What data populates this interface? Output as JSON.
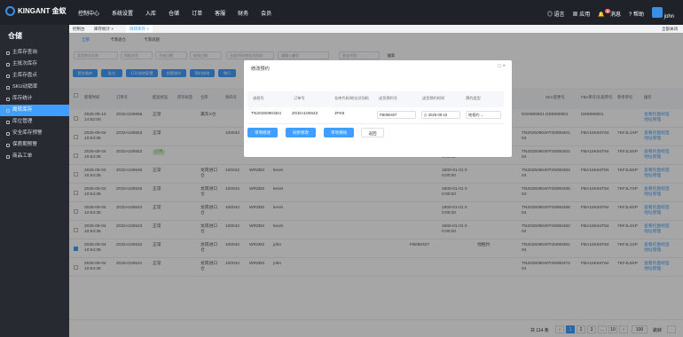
{
  "app": {
    "brand": "KINGANT 金蚁",
    "nav": [
      "控制中心",
      "系统设置",
      "入库",
      "仓储",
      "订单",
      "客服",
      "财务",
      "会员"
    ],
    "lang": "语言",
    "apps": "应用",
    "news": "消息",
    "news_count": "8",
    "help": "帮助",
    "user": "john"
  },
  "sidebar": {
    "title": "仓储",
    "items": [
      "主库存查询",
      "主批次库存",
      "主库存盘点",
      "SKU动销率",
      "库存统计",
      "周转库存",
      "库位管理",
      "安全库存预警",
      "保质期预警",
      "商品工单"
    ],
    "active": 5
  },
  "tabs": {
    "items": [
      "控制台",
      "库存统计",
      "周转库存"
    ],
    "right": "全部关闭"
  },
  "subtabs": [
    "全部",
    "卡落退仓",
    "卡落退越"
  ],
  "filters": [
    "发货库存仓库",
    "同批次号",
    "开始日期",
    "结束日期",
    "全部代码/地址识别码",
    "请输入编号",
    "安全代码",
    "搜索"
  ],
  "buttons": [
    "提交备库",
    "批次",
    "打印流转配置",
    "前置操作",
    "预约修改",
    "增行"
  ],
  "table": {
    "headers": [
      "新增时间",
      "订单号",
      "配送状态",
      "库存标签",
      "仓库",
      "条码号",
      "仓库代码",
      "操作人",
      "关联人",
      "发货代码",
      "在途状态",
      "备注",
      "SKU变更号",
      "FBA单号/头程单号",
      "参考单号",
      "操作"
    ],
    "rows": [
      {
        "time": "2025-09-10\n14:52:00",
        "order": "ZGDA100656",
        "status": "正常",
        "tag": "",
        "wh": "美东X仓",
        "code": "",
        "op": "",
        "rel": "",
        "ship": "",
        "date": "",
        "remark": "",
        "sn": "DG0900601",
        "sku": "DD9090001",
        "fba": "DD9090001",
        "ref": "",
        "act": "查看托盘标签\n地址管理",
        "checked": false
      },
      {
        "time": "2025-09-04\n10:54:35",
        "order": "ZGDA100653",
        "status": "正常",
        "tag": "",
        "wh": "",
        "code": "100042",
        "op": "",
        "rel": "",
        "ship": "",
        "date": "",
        "remark": "",
        "sn": "TN20250904\n04",
        "sku": "YP25090401",
        "fba": "FBA15K94T84",
        "ref": "7KFJL1XP",
        "act": "查看托盘标签\n地址管理",
        "checked": false
      },
      {
        "time": "2025-09-04\n10:54:35",
        "order": "ZGDA100652",
        "status": "已预",
        "tag": "",
        "wh": "",
        "code": "",
        "op": "",
        "rel": "",
        "ship": "FB090402",
        "date": "2025-09-06 0\n0:00:00",
        "remark": "卡框约",
        "sn": "TN20250904\n04",
        "sku": "YP25090402",
        "fba": "FBA15K94T84",
        "ref": "7KFJL5XP",
        "act": "查看托盘标签\n地址管理",
        "checked": false
      },
      {
        "time": "2025-09-04\n10:54:35",
        "order": "ZGDA100646",
        "status": "正常",
        "tag": "",
        "wh": "龙岗进口\n仓",
        "code": "100042",
        "op": "WRZBS",
        "rel": "kevin",
        "ship": "",
        "date": "1900-01-01 0\n0:00:00",
        "remark": "",
        "sn": "TN20250904\n04",
        "sku": "YP25090484",
        "fba": "FBA15K94T84",
        "ref": "7KFJL6XP",
        "act": "查看托盘标签\n地址管理",
        "checked": false
      },
      {
        "time": "2025-09-04\n10:54:35",
        "order": "ZGDA100645",
        "status": "正常",
        "tag": "",
        "wh": "龙岗进口\n仓",
        "code": "100042",
        "op": "WRZBS",
        "rel": "kevin",
        "ship": "",
        "date": "1900-01-01 0\n0:00:00",
        "remark": "",
        "sn": "TN20250904\n04",
        "sku": "YP25090485",
        "fba": "FBA15K94T84",
        "ref": "7KFJL7XP",
        "act": "查看托盘标签\n地址管理",
        "checked": false
      },
      {
        "time": "2025-09-04\n10:54:35",
        "order": "ZGDA100644",
        "status": "正常",
        "tag": "",
        "wh": "龙岗进口\n仓",
        "code": "100042",
        "op": "WRZBS",
        "rel": "kevin",
        "ship": "",
        "date": "1900-01-01 0\n0:00:00",
        "remark": "",
        "sn": "TN20250904\n04",
        "sku": "YP25090486",
        "fba": "FBA15K94T84",
        "ref": "7KFJL8XP",
        "act": "查看托盘标签\n地址管理",
        "checked": false
      },
      {
        "time": "2025-09-04\n10:54:35",
        "order": "ZGDA100643",
        "status": "正常",
        "tag": "",
        "wh": "龙岗进口\n仓",
        "code": "100042",
        "op": "WRZBS",
        "rel": "kevin",
        "ship": "",
        "date": "1900-01-01 0\n0:00:00",
        "remark": "",
        "sn": "TN20250904\n04",
        "sku": "YP25090482",
        "fba": "FBA15K94T84",
        "ref": "7KFJL4XP",
        "act": "查看托盘标签\n地址管理",
        "checked": false
      },
      {
        "time": "2025-09-04\n10:54:35",
        "order": "ZGDA100642",
        "status": "正常",
        "tag": "",
        "wh": "龙岗进口\n仓",
        "code": "100042",
        "op": "WRZBS",
        "rel": "john",
        "ship": "FB090407",
        "date": "",
        "remark": "地框约",
        "sn": "TN20250904\n04",
        "sku": "YP25090481",
        "fba": "FBA15K94T84",
        "ref": "7KFJL1XP",
        "act": "查看托盘标签\n地址管理",
        "checked": true
      },
      {
        "time": "2025-09-04\n10:54:35",
        "order": "ZGDA100641",
        "status": "正常",
        "tag": "",
        "wh": "龙岗进口\n仓",
        "code": "100042",
        "op": "WRZBS",
        "rel": "john",
        "ship": "",
        "date": "",
        "remark": "",
        "sn": "TN20250904\n04",
        "sku": "YP25090474",
        "fba": "FBA15K94T84",
        "ref": "7KFJL9XP",
        "act": "查看托盘标签\n地址管理",
        "checked": false
      }
    ]
  },
  "pagination": {
    "total": "共 114 条",
    "pages": [
      "1",
      "2",
      "3",
      "...",
      "10"
    ],
    "current": "1",
    "size": "100",
    "jump": "跳转"
  },
  "modal": {
    "title": "修改预约",
    "headers": [
      "流程号",
      "订单号",
      "仓库代码/地址识别码",
      "送货预约号",
      "送货预约时间",
      "预约类型"
    ],
    "row": {
      "flow": "TN20250904D4",
      "order": "ZGDA100642",
      "wh": "JFK8",
      "appt": "FB090407",
      "date": "2025-09-10",
      "type": "地框约"
    },
    "buttons": [
      "单项修改",
      "同步修改",
      "单项清除",
      "返回"
    ]
  }
}
